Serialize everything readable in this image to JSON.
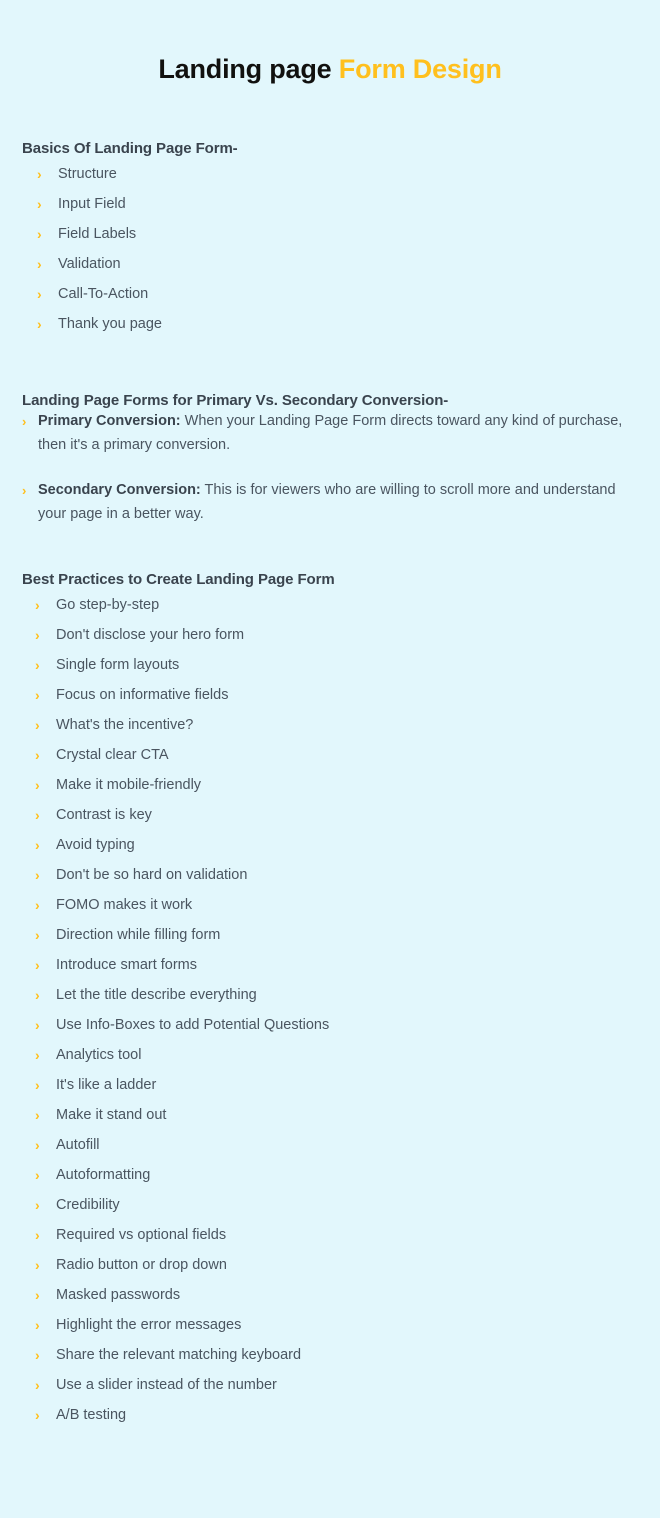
{
  "page": {
    "background_color": "#e2f7fc",
    "accent_color": "#ffc01e",
    "heading_color": "#3a444e",
    "body_text_color": "#4a5560"
  },
  "title": {
    "part_dark": "Landing page",
    "part_accent": "Form Design"
  },
  "sections": {
    "basics": {
      "heading": "Basics Of Landing Page Form-",
      "items": [
        {
          "bullet": "chevron-right-icon",
          "label": "Structure"
        },
        {
          "bullet": "chevron-right-icon",
          "label": "Input Field"
        },
        {
          "bullet": "chevron-right-icon",
          "label": "Field Labels"
        },
        {
          "bullet": "chevron-right-icon",
          "label": "Validation"
        },
        {
          "bullet": "chevron-right-icon",
          "label": "Call-To-Action"
        },
        {
          "bullet": "chevron-right-icon",
          "label": "Thank you page"
        }
      ]
    },
    "conversion": {
      "heading": "Landing Page Forms for Primary Vs. Secondary Conversion-",
      "items": [
        {
          "bullet": "chevron-right-icon",
          "lead": "Primary Conversion:",
          "text": " When your Landing Page Form directs toward any kind of purchase, then it's a primary conversion."
        },
        {
          "bullet": "chevron-right-icon",
          "lead": "Secondary Conversion:",
          "text": " This is for viewers who are willing to scroll more and understand your page in a better way."
        }
      ]
    },
    "best_practices": {
      "heading": "Best Practices to Create Landing Page Form",
      "items": [
        {
          "bullet": "chevron-right-icon",
          "label": "Go step-by-step"
        },
        {
          "bullet": "chevron-right-icon",
          "label": "Don't disclose your hero form"
        },
        {
          "bullet": "chevron-right-icon",
          "label": "Single form layouts"
        },
        {
          "bullet": "chevron-right-icon",
          "label": "Focus on informative fields"
        },
        {
          "bullet": "chevron-right-icon",
          "label": "What's the incentive?"
        },
        {
          "bullet": "chevron-right-icon",
          "label": "Crystal clear CTA"
        },
        {
          "bullet": "chevron-right-icon",
          "label": "Make it mobile-friendly"
        },
        {
          "bullet": "chevron-right-icon",
          "label": "Contrast is key"
        },
        {
          "bullet": "chevron-right-icon",
          "label": "Avoid typing"
        },
        {
          "bullet": "chevron-right-icon",
          "label": "Don't be so hard on validation"
        },
        {
          "bullet": "chevron-right-icon",
          "label": "FOMO makes it work"
        },
        {
          "bullet": "chevron-right-icon",
          "label": "Direction while filling form"
        },
        {
          "bullet": "chevron-right-icon",
          "label": "Introduce smart forms"
        },
        {
          "bullet": "chevron-right-icon",
          "label": "Let the title describe everything"
        },
        {
          "bullet": "chevron-right-icon",
          "label": "Use Info-Boxes to add Potential Questions"
        },
        {
          "bullet": "chevron-right-icon",
          "label": "Analytics tool"
        },
        {
          "bullet": "chevron-right-icon",
          "label": "It's like a ladder"
        },
        {
          "bullet": "chevron-right-icon",
          "label": "Make it stand out"
        },
        {
          "bullet": "chevron-right-icon",
          "label": "Autofill"
        },
        {
          "bullet": "chevron-right-icon",
          "label": "Autoformatting"
        },
        {
          "bullet": "chevron-right-icon",
          "label": "Credibility"
        },
        {
          "bullet": "chevron-right-icon",
          "label": "Required vs optional fields"
        },
        {
          "bullet": "chevron-right-icon",
          "label": "Radio button or drop down"
        },
        {
          "bullet": "chevron-right-icon",
          "label": "Masked passwords"
        },
        {
          "bullet": "chevron-right-icon",
          "label": "Highlight the error messages"
        },
        {
          "bullet": "chevron-right-icon",
          "label": "Share the relevant matching keyboard"
        },
        {
          "bullet": "chevron-right-icon",
          "label": "Use a slider instead of the number"
        },
        {
          "bullet": "chevron-right-icon",
          "label": "A/B testing"
        }
      ]
    }
  },
  "icons": {
    "chevron_glyph": "›"
  }
}
